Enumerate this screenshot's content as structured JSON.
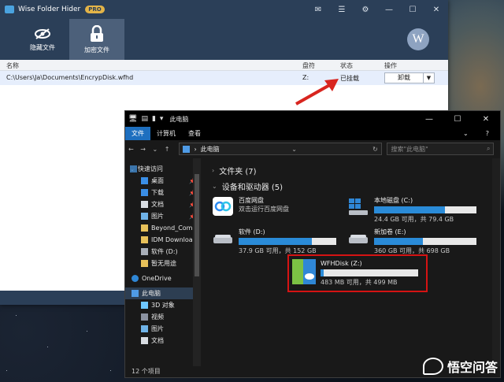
{
  "wfh": {
    "title": "Wise Folder Hider",
    "badge": "PRO",
    "toolbar": {
      "hide_file_label": "隐藏文件",
      "encrypt_file_label": "加密文件"
    },
    "avatar_letter": "W",
    "columns": {
      "name": "名称",
      "drive": "盘符",
      "status": "状态",
      "action": "操作"
    },
    "rows": [
      {
        "name": "C:\\Users\\Ja\\Documents\\EncrypDisk.wfhd",
        "drive": "Z:",
        "status": "已挂载",
        "action": "卸载"
      }
    ]
  },
  "explorer": {
    "title": "此电脑",
    "ribbon": {
      "file": "文件",
      "computer": "计算机",
      "view": "查看"
    },
    "address": "此电脑",
    "search_placeholder": "搜索\"此电脑\"",
    "nav": [
      {
        "label": "快速访问",
        "icon": "star-icon"
      },
      {
        "label": "桌面",
        "icon": "desktop-icon",
        "pinned": true
      },
      {
        "label": "下载",
        "icon": "download-icon",
        "pinned": true
      },
      {
        "label": "文档",
        "icon": "document-icon",
        "pinned": true
      },
      {
        "label": "图片",
        "icon": "picture-icon",
        "pinned": true
      },
      {
        "label": "Beyond_Compa",
        "icon": "folder-icon"
      },
      {
        "label": "IDM Download",
        "icon": "folder-icon"
      },
      {
        "label": "软件 (D:)",
        "icon": "drive-icon"
      },
      {
        "label": "暂无用途",
        "icon": "folder-icon"
      },
      {
        "label": "OneDrive",
        "icon": "onedrive-icon"
      },
      {
        "label": "此电脑",
        "icon": "pc-icon"
      },
      {
        "label": "3D 对象",
        "icon": "3d-objects-icon"
      },
      {
        "label": "视频",
        "icon": "video-icon"
      },
      {
        "label": "图片",
        "icon": "picture-icon"
      },
      {
        "label": "文档",
        "icon": "document-icon"
      }
    ],
    "folders_group": "文件夹 (7)",
    "devices_group": "设备和驱动器 (5)",
    "devices": [
      {
        "name": "百度网盘",
        "sub": "双击运行百度网盘"
      },
      {
        "name": "本地磁盘 (C:)",
        "sub": "24.4 GB 可用，共 79.4 GB",
        "used_fraction": 0.69
      },
      {
        "name": "软件 (D:)",
        "sub": "37.9 GB 可用，共 152 GB",
        "used_fraction": 0.75
      },
      {
        "name": "新加卷 (E:)",
        "sub": "360 GB 可用，共 698 GB",
        "used_fraction": 0.48
      },
      {
        "name": "WFHDisk (Z:)",
        "sub": "483 MB 可用，共 499 MB",
        "used_fraction": 0.03
      }
    ],
    "status": "12 个项目"
  },
  "watermark": "悟空问答",
  "colors": {
    "wfh_header": "#2b3f58",
    "accent_blue": "#2a8bd8",
    "highlight_red": "#d51313"
  }
}
